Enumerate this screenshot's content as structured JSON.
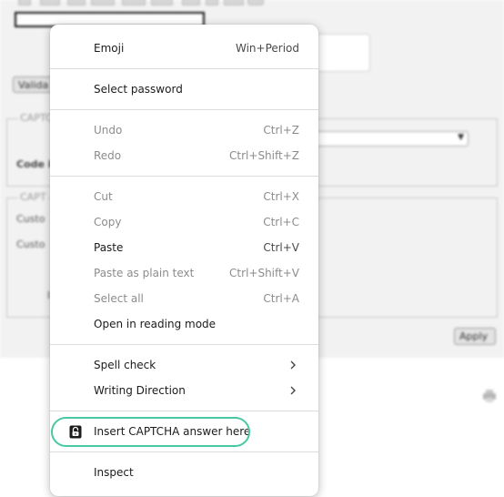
{
  "background": {
    "validate_button": "Valida",
    "captcha_legend": "CAPTC",
    "code_label": "Code i",
    "captcha_legend_2": "CAPT",
    "custom_label_1": "Custo",
    "custom_label_2": "Custo",
    "stray_letter": "I",
    "apply_button": "Apply"
  },
  "menu": {
    "items": [
      {
        "label": "Emoji",
        "shortcut": "Win+Period"
      },
      {
        "label": "Select password",
        "shortcut": ""
      },
      {
        "label": "Undo",
        "shortcut": "Ctrl+Z",
        "disabled": true
      },
      {
        "label": "Redo",
        "shortcut": "Ctrl+Shift+Z",
        "disabled": true
      },
      {
        "label": "Cut",
        "shortcut": "Ctrl+X",
        "disabled": true
      },
      {
        "label": "Copy",
        "shortcut": "Ctrl+C",
        "disabled": true
      },
      {
        "label": "Paste",
        "shortcut": "Ctrl+V"
      },
      {
        "label": "Paste as plain text",
        "shortcut": "Ctrl+Shift+V",
        "disabled": true
      },
      {
        "label": "Select all",
        "shortcut": "Ctrl+A",
        "disabled": true
      },
      {
        "label": "Open in reading mode",
        "shortcut": ""
      },
      {
        "label": "Spell check",
        "submenu": true
      },
      {
        "label": "Writing Direction",
        "submenu": true
      },
      {
        "label": "Insert CAPTCHA answer here",
        "icon": "lock-icon",
        "highlighted": true
      },
      {
        "label": "Inspect",
        "shortcut": ""
      }
    ]
  },
  "colors": {
    "highlight_ring": "#46c8a2",
    "disabled_text": "#8c8c8c",
    "menu_background": "#ffffff"
  }
}
